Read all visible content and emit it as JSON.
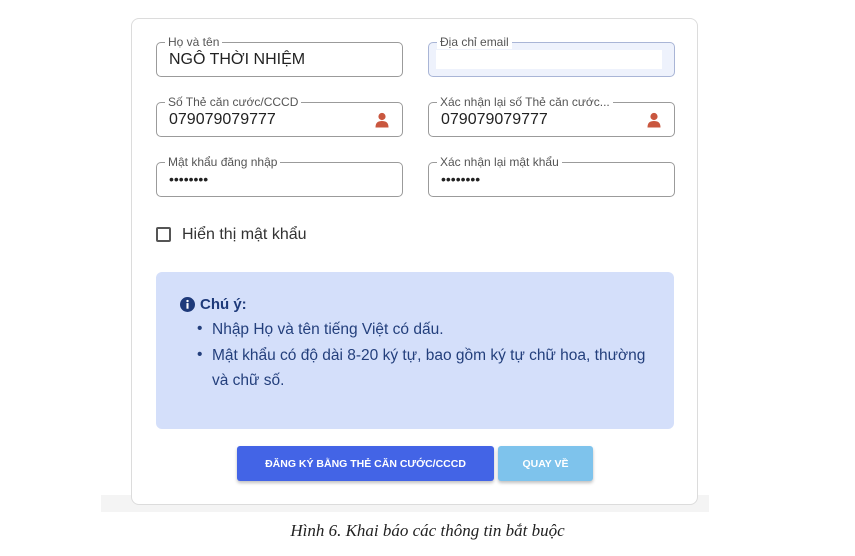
{
  "form": {
    "fullname": {
      "label": "Họ và tên",
      "value": "NGÔ THỜI NHIỆM"
    },
    "email": {
      "label": "Địa chỉ email",
      "value": ""
    },
    "id_card": {
      "label": "Số Thẻ căn cước/CCCD",
      "value": "079079079777",
      "icon": "user-icon"
    },
    "id_card_confirm": {
      "label": "Xác nhận lại số Thẻ căn cước...",
      "value": "079079079777",
      "icon": "user-icon"
    },
    "password": {
      "label": "Mật khẩu đăng nhập",
      "value": "••••••••"
    },
    "password_confirm": {
      "label": "Xác nhận lại mật khẩu",
      "value": "••••••••"
    },
    "show_password": {
      "label": "Hiển thị mật khẩu",
      "checked": false
    }
  },
  "note": {
    "icon": "info-icon",
    "title": "Chú ý:",
    "items": [
      "Nhập Họ và tên tiếng Việt có dấu.",
      "Mật khẩu có độ dài 8-20 ký tự, bao gồm ký tự chữ hoa, thường",
      "và chữ số."
    ]
  },
  "buttons": {
    "register": "ĐĂNG KÝ BẰNG THẺ CĂN CƯỚC/CCCD",
    "back": "QUAY VỀ"
  },
  "caption": "Hình 6. Khai báo các thông tin bắt buộc",
  "colors": {
    "primary": "#4364e6",
    "secondary": "#7ec3ec",
    "note_bg": "#d4dffa",
    "icon": "#c9573f"
  }
}
